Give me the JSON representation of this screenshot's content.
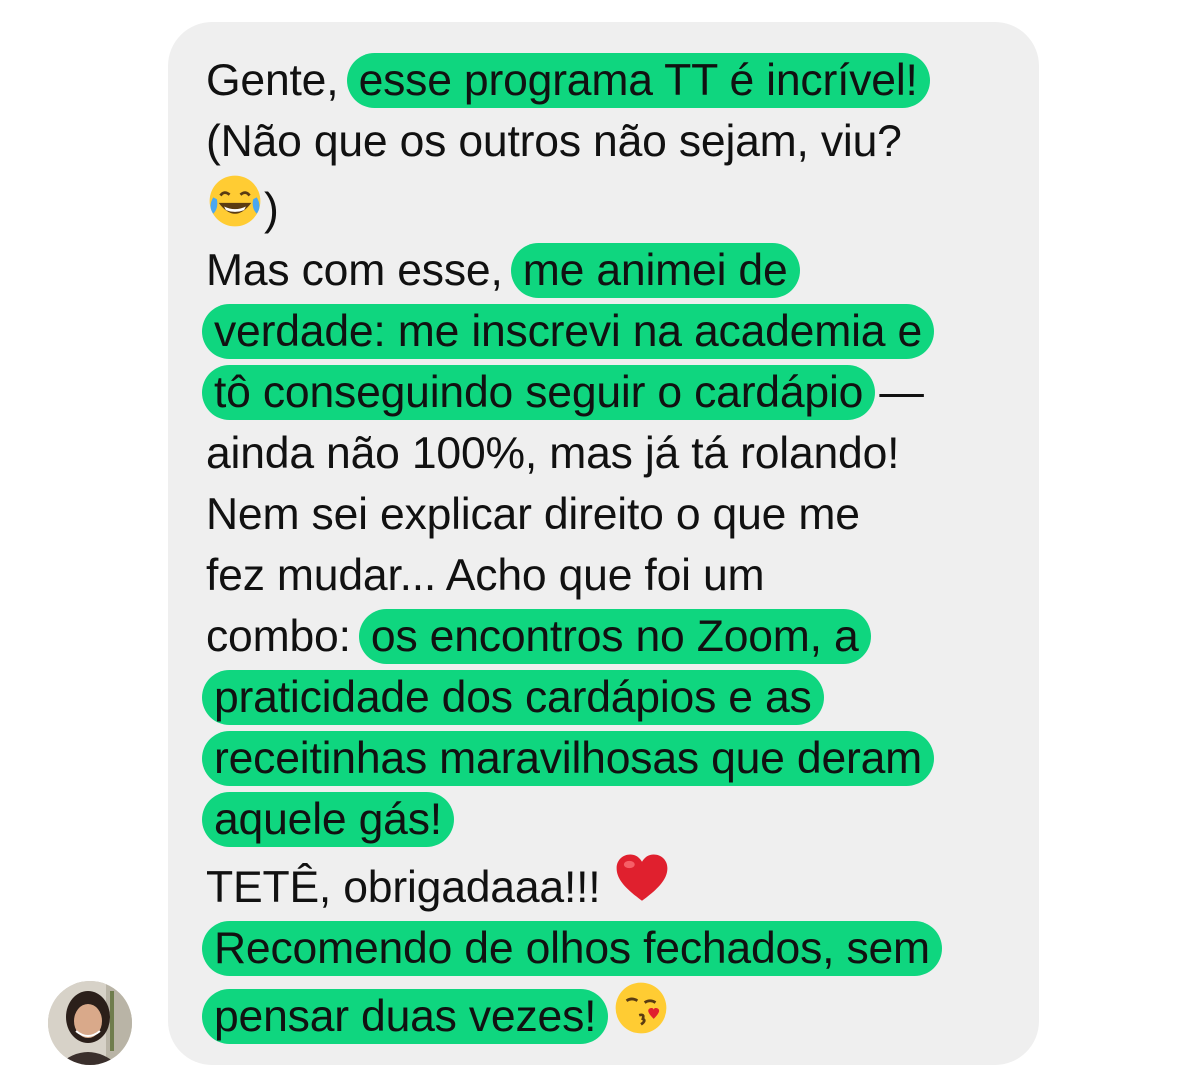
{
  "message": {
    "p1": {
      "a": "Gente, ",
      "hl1": "esse programa TT é incrível!",
      "line2": "(Não que os outros não sejam, viu?",
      "emoji": "laughing-tears-emoji",
      "close": ")"
    },
    "p2": {
      "a": "Mas com esse, ",
      "hl1": "me animei de",
      "hl2": "verdade: me inscrevi na academia e",
      "hl3": "tô conseguindo seguir o cardápio",
      "dash": " —",
      "line4": "ainda não 100%, mas já tá rolando!"
    },
    "p3": {
      "line1": "Nem sei explicar direito o que me",
      "line2": "fez mudar... Acho que foi um",
      "a": "combo: ",
      "hl1": "os encontros no Zoom, a",
      "hl2": "praticidade dos cardápios e as",
      "hl3": "receitinhas maravilhosas que deram",
      "hl4": "aquele gás!"
    },
    "p4": {
      "text": "TETÊ, obrigadaaa!!! ",
      "emoji": "red-heart-emoji"
    },
    "p5": {
      "hl1": "Recomendo de olhos fechados, sem",
      "hl2": "pensar duas vezes!",
      "emoji": "kissing-face-emoji"
    }
  },
  "colors": {
    "bubble": "#efefef",
    "highlight": "#0fd67f",
    "text": "#111111"
  }
}
